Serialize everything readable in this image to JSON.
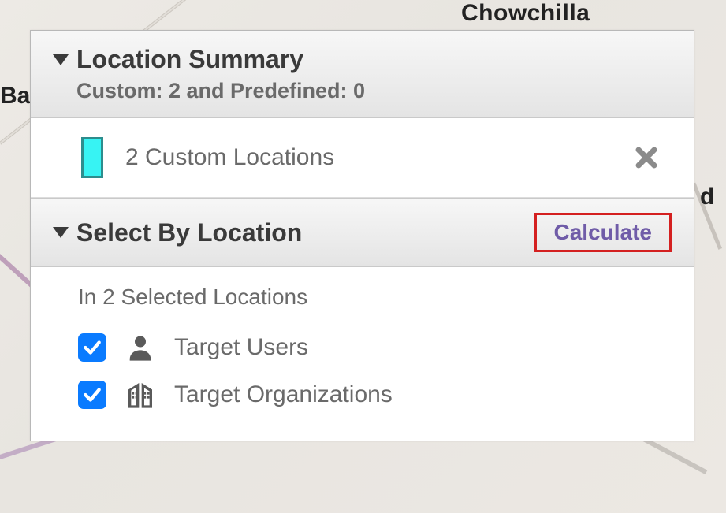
{
  "map": {
    "label_top_right": "Chowchilla",
    "label_left_fragment": "Ba",
    "label_right_fragment": "d"
  },
  "panel": {
    "location_summary": {
      "title": "Location Summary",
      "subtitle": "Custom: 2 and Predefined: 0",
      "custom_row_label": "2 Custom Locations"
    },
    "select_by_location": {
      "title": "Select By Location",
      "calculate_label": "Calculate",
      "subheading": "In 2 Selected Locations",
      "items": [
        {
          "label": "Target Users",
          "checked": true,
          "icon": "user-icon"
        },
        {
          "label": "Target Organizations",
          "checked": true,
          "icon": "building-icon"
        }
      ]
    }
  }
}
